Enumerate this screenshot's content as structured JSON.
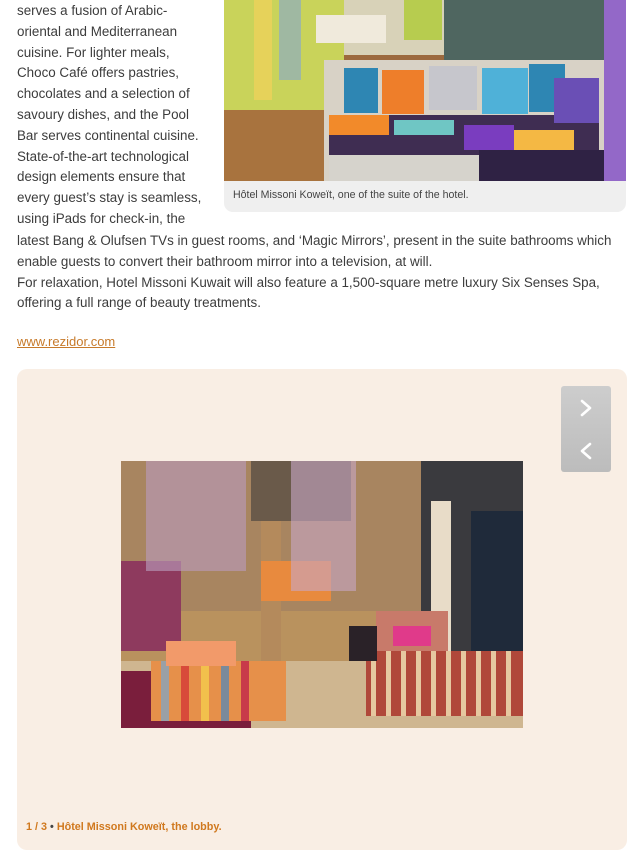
{
  "article": {
    "column_lines": [
      "serves a fusion of Arabic-",
      "oriental and Mediterranean",
      "cuisine. For lighter meals,",
      "Choco Café offers pastries,",
      "chocolates and a selection of",
      "savoury dishes, and the Pool",
      "Bar serves continental cuisine.",
      "State-of-the-art technological",
      "design elements ensure that",
      "every guest’s stay is seamless,",
      "using iPads for check-in, the"
    ],
    "full_lines": [
      "latest Bang & Olufsen TVs in guest rooms, and ‘Magic Mirrors’, present in the suite bathrooms which",
      "enable guests to convert their bathroom mirror into a television, at will.",
      "For relaxation, Hotel Missoni Kuwait will also feature a 1,500-square metre luxury Six Senses Spa,",
      "offering a full range of beauty treatments."
    ],
    "link_text": "www.rezidor.com"
  },
  "top_figure": {
    "image_description": "Colorful suite lounge with floral patterned sofa and blue cushions",
    "caption": "Hôtel Missoni Koweït, one of the suite of the hotel."
  },
  "gallery": {
    "image_description": "Hotel lobby with striped sofas and purple bead chandeliers",
    "current": "1",
    "total": "3",
    "separator_slash": " / ",
    "bullet": " • ",
    "caption": "Hôtel Missoni Koweït, the lobby.",
    "next_icon": "chevron-right-icon",
    "prev_icon": "chevron-left-icon"
  }
}
